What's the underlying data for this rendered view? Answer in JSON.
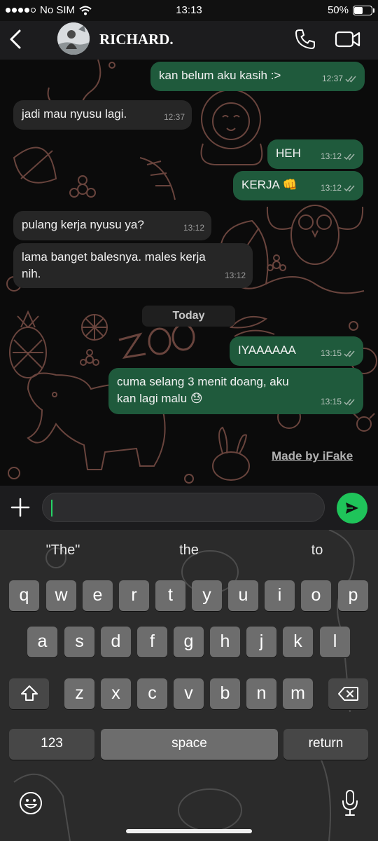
{
  "status_bar": {
    "carrier": "No SIM",
    "time": "13:13",
    "battery": "50%",
    "battery_level": 0.5
  },
  "header": {
    "contact_name": "RICHARD."
  },
  "messages": [
    {
      "direction": "out",
      "text": "kan belum aku kasih :>",
      "time": "12:37",
      "status": "read"
    },
    {
      "direction": "in",
      "text": "jadi mau nyusu lagi.",
      "time": "12:37"
    },
    {
      "direction": "out",
      "text": "HEH",
      "time": "13:12",
      "status": "read"
    },
    {
      "direction": "out",
      "text": "KERJA 👊",
      "time": "13:12",
      "status": "read"
    },
    {
      "direction": "in",
      "text": "pulang kerja nyusu ya?",
      "time": "13:12"
    },
    {
      "direction": "in",
      "text": "lama banget balesnya. males kerja nih.",
      "time": "13:12"
    },
    {
      "direction": "out",
      "text": "IYAAAAAA",
      "time": "13:15",
      "status": "read"
    },
    {
      "direction": "out",
      "text": "cuma selang 3 menit doang, aku kan lagi malu 😓",
      "time": "13:15",
      "status": "read"
    }
  ],
  "day_divider": "Today",
  "watermark": "Made by iFake",
  "composer": {
    "value": ""
  },
  "keyboard": {
    "suggestions": [
      "\"The\"",
      "the",
      "to"
    ],
    "row1": [
      "q",
      "w",
      "e",
      "r",
      "t",
      "y",
      "u",
      "i",
      "o",
      "p"
    ],
    "row2": [
      "a",
      "s",
      "d",
      "f",
      "g",
      "h",
      "j",
      "k",
      "l"
    ],
    "row3": [
      "z",
      "x",
      "c",
      "v",
      "b",
      "n",
      "m"
    ],
    "numbers_label": "123",
    "space_label": "space",
    "return_label": "return"
  },
  "colors": {
    "outgoing_bubble": "#1f5a3c",
    "incoming_bubble": "#262626",
    "send_button": "#1fc45a",
    "cursor": "#25d366"
  }
}
